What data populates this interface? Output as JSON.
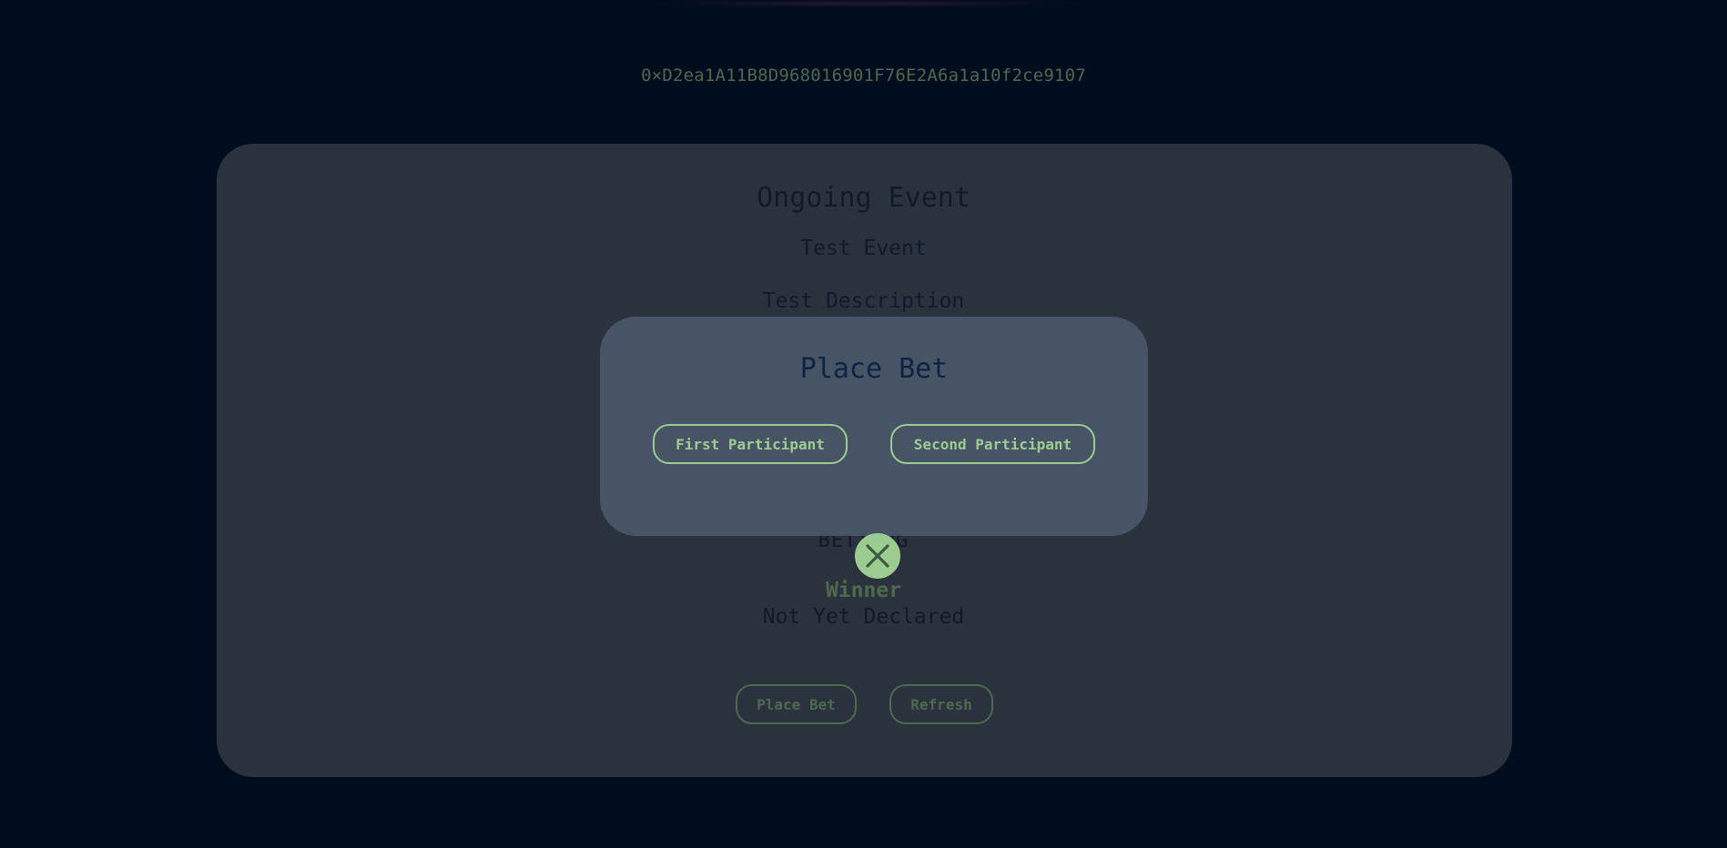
{
  "wallet_address": "0×D2ea1A11B8D968016901F76E2A6a1a10f2ce9107",
  "event_card": {
    "title": "Ongoing Event",
    "event_name": "Test Event",
    "description": "Test Description",
    "status": "BETTING",
    "winner_label": "Winner",
    "winner_value": "Not Yet Declared",
    "place_bet_label": "Place Bet",
    "refresh_label": "Refresh"
  },
  "modal": {
    "title": "Place Bet",
    "first_participant_label": "First Participant",
    "second_participant_label": "Second Participant",
    "close_icon": "close-icon"
  },
  "colors": {
    "background": "#000d1f",
    "card": "#2a323d",
    "modal": "#475465",
    "accent": "#9ccc90",
    "accent_dim": "#4d6a4f",
    "dark_text": "#0f1b2b"
  }
}
